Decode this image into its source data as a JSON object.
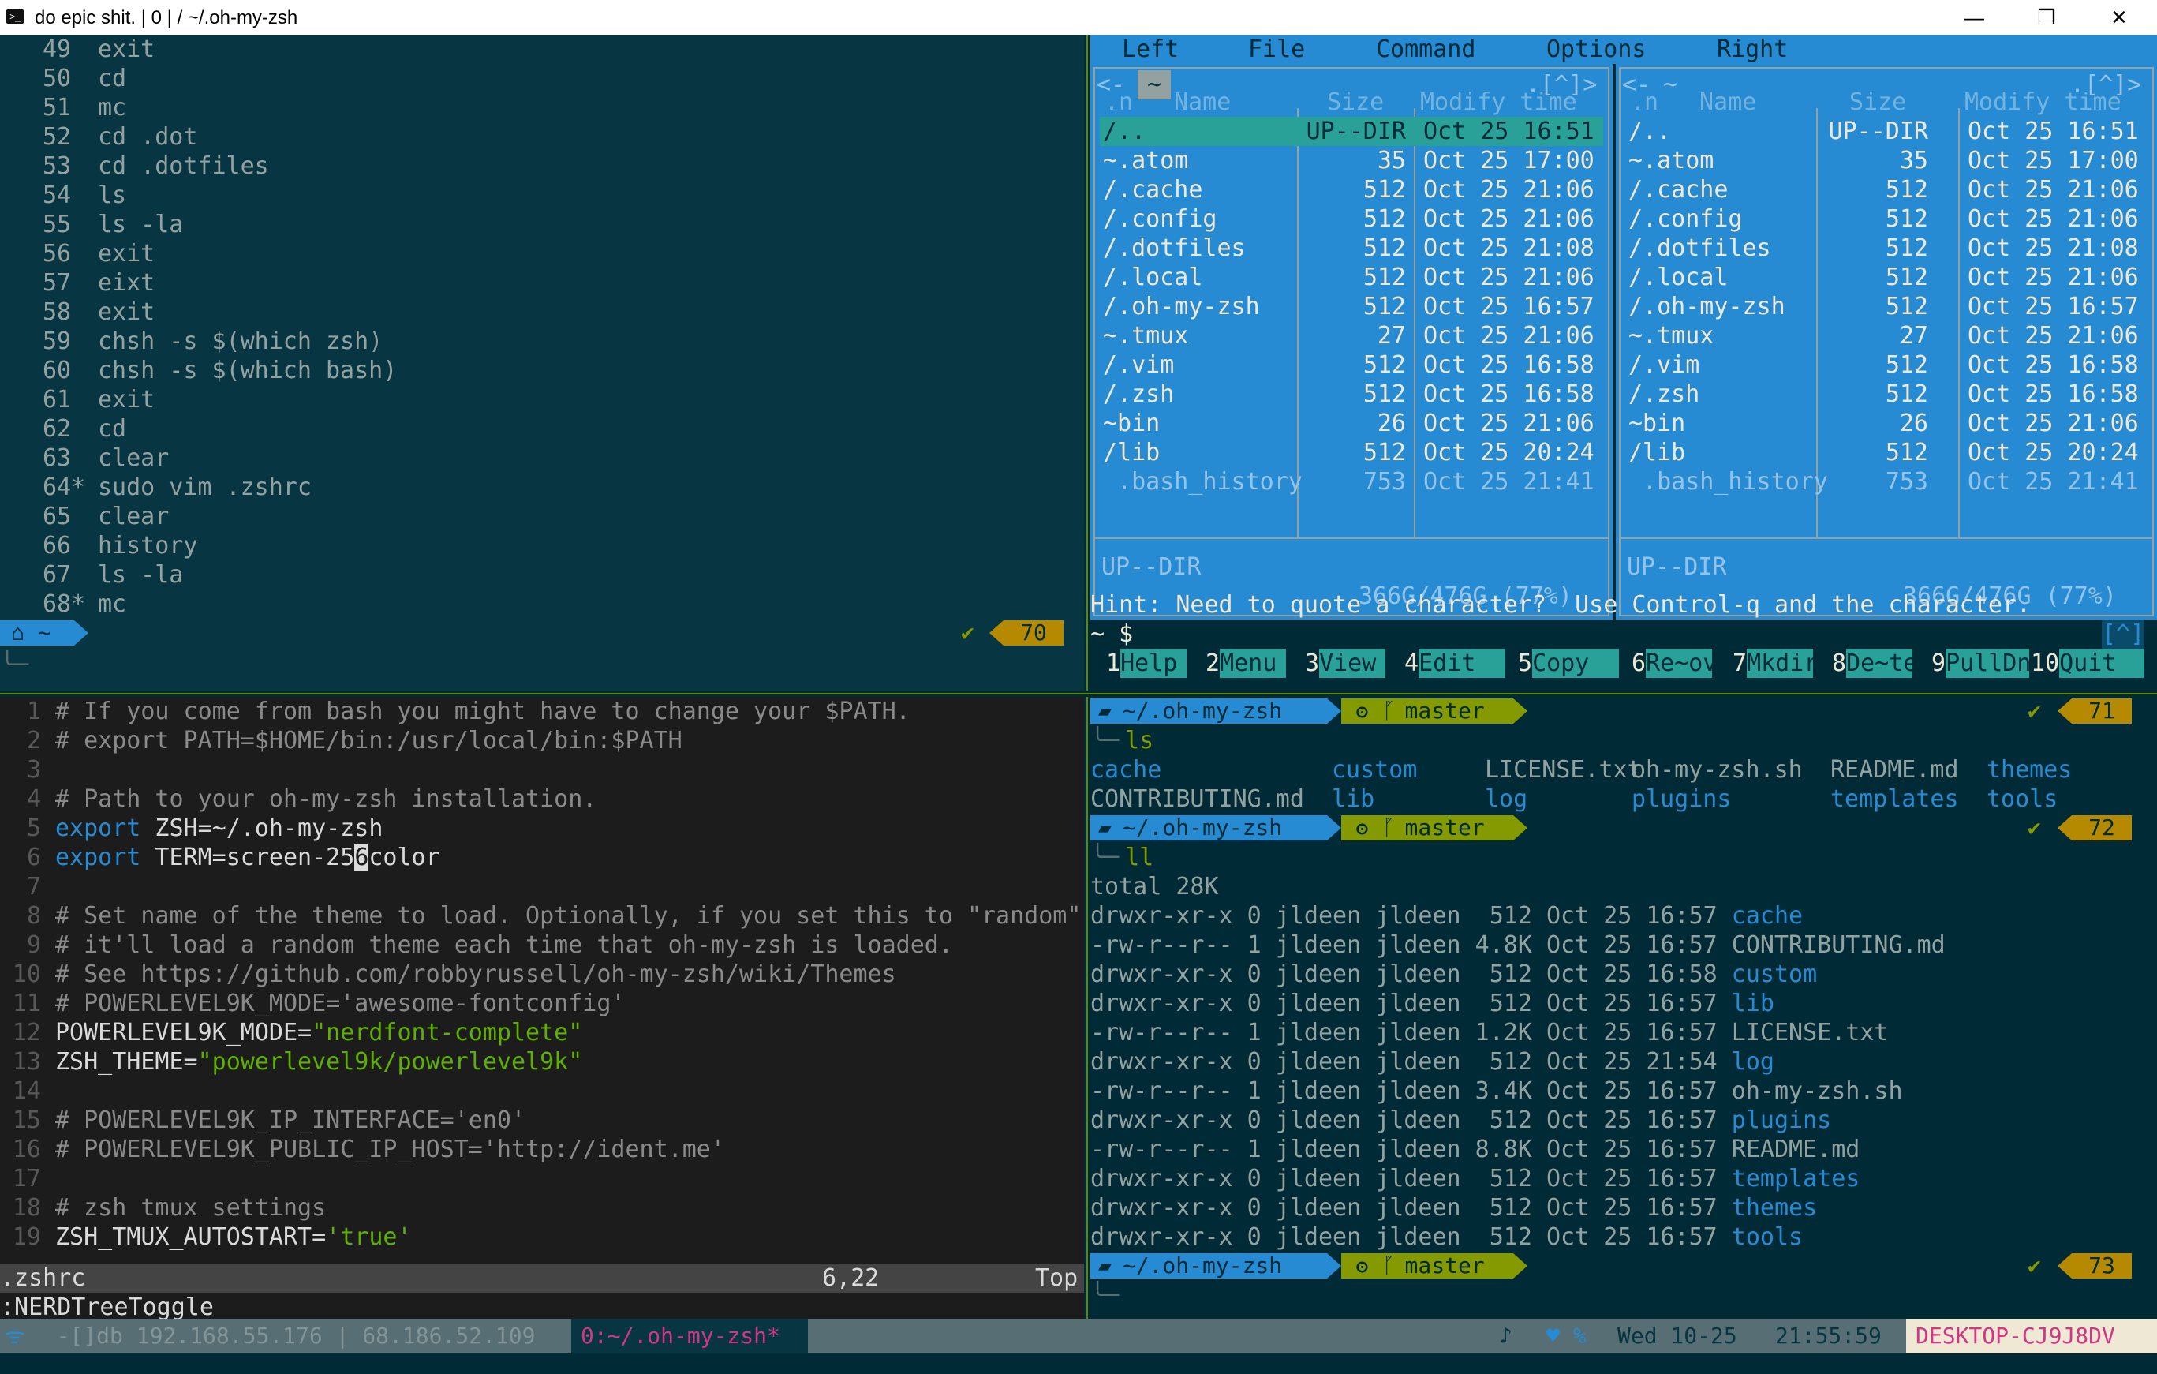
{
  "window": {
    "title": "do epic shit. | 0 | / ~/.oh-my-zsh",
    "minimize": "—",
    "maximize": "❐",
    "close": "✕"
  },
  "history": {
    "lines": [
      {
        "n": "49",
        "cmd": "exit"
      },
      {
        "n": "50",
        "cmd": "cd"
      },
      {
        "n": "51",
        "cmd": "mc"
      },
      {
        "n": "52",
        "cmd": "cd .dot"
      },
      {
        "n": "53",
        "cmd": "cd .dotfiles"
      },
      {
        "n": "54",
        "cmd": "ls"
      },
      {
        "n": "55",
        "cmd": "ls -la"
      },
      {
        "n": "56",
        "cmd": "exit"
      },
      {
        "n": "57",
        "cmd": "eixt"
      },
      {
        "n": "58",
        "cmd": "exit"
      },
      {
        "n": "59",
        "cmd": "chsh -s $(which zsh)"
      },
      {
        "n": "60",
        "cmd": "chsh -s $(which bash)"
      },
      {
        "n": "61",
        "cmd": "exit"
      },
      {
        "n": "62",
        "cmd": "cd"
      },
      {
        "n": "63",
        "cmd": "clear"
      },
      {
        "n": "64*",
        "cmd": "sudo vim .zshrc"
      },
      {
        "n": "65",
        "cmd": "clear"
      },
      {
        "n": "66",
        "cmd": "history"
      },
      {
        "n": "67",
        "cmd": "ls -la"
      },
      {
        "n": "68*",
        "cmd": "mc"
      }
    ],
    "prompt_dir": "~",
    "prompt_home_icon": "⌂",
    "check": "✔",
    "count": "70",
    "cursor_line": "╰─"
  },
  "mc": {
    "menu": [
      "Left",
      "File",
      "Command",
      "Options",
      "Right"
    ],
    "left_path": "~",
    "corner": ".[^]>",
    "left_marker": "<-",
    "headers": {
      "n": ".n",
      "name": "Name",
      "size": "Size",
      "mtime": "Modify time"
    },
    "rows": [
      {
        "name": "/..",
        "size": "UP--DIR",
        "date": "Oct 25 16:51"
      },
      {
        "name": "~.atom",
        "size": "35",
        "date": "Oct 25 17:00"
      },
      {
        "name": "/.cache",
        "size": "512",
        "date": "Oct 25 21:06"
      },
      {
        "name": "/.config",
        "size": "512",
        "date": "Oct 25 21:06"
      },
      {
        "name": "/.dotfiles",
        "size": "512",
        "date": "Oct 25 21:08"
      },
      {
        "name": "/.local",
        "size": "512",
        "date": "Oct 25 21:06"
      },
      {
        "name": "/.oh-my-zsh",
        "size": "512",
        "date": "Oct 25 16:57"
      },
      {
        "name": "~.tmux",
        "size": "27",
        "date": "Oct 25 21:06"
      },
      {
        "name": "/.vim",
        "size": "512",
        "date": "Oct 25 16:58"
      },
      {
        "name": "/.zsh",
        "size": "512",
        "date": "Oct 25 16:58"
      },
      {
        "name": "~bin",
        "size": "26",
        "date": "Oct 25 21:06"
      },
      {
        "name": "/lib",
        "size": "512",
        "date": "Oct 25 20:24"
      },
      {
        "name": " .bash_history",
        "size": "753",
        "date": "Oct 25 21:41"
      }
    ],
    "footer": "UP--DIR",
    "disk": "366G/476G (77%)",
    "hint": "Hint: Need to quote a character?  Use Control-q and the character.",
    "prompt": "~ $",
    "hint_corner": "[^]",
    "fkeys": [
      {
        "n": "1",
        "l": "Help"
      },
      {
        "n": "2",
        "l": "Menu"
      },
      {
        "n": "3",
        "l": "View"
      },
      {
        "n": "4",
        "l": "Edit"
      },
      {
        "n": "5",
        "l": "Copy"
      },
      {
        "n": "6",
        "l": "Re~ov"
      },
      {
        "n": "7",
        "l": "Mkdir"
      },
      {
        "n": "8",
        "l": "De~te"
      },
      {
        "n": "9",
        "l": "PullDn"
      },
      {
        "n": "10",
        "l": "Quit"
      }
    ]
  },
  "vim": {
    "lines": [
      {
        "n": "1",
        "parts": [
          {
            "c": "vc",
            "t": "# If you come from bash you might have to change your $PATH."
          }
        ]
      },
      {
        "n": "2",
        "parts": [
          {
            "c": "vc",
            "t": "# export PATH=$HOME/bin:/usr/local/bin:$PATH"
          }
        ]
      },
      {
        "n": "3",
        "parts": []
      },
      {
        "n": "4",
        "parts": [
          {
            "c": "vc",
            "t": "# Path to your oh-my-zsh installation."
          }
        ]
      },
      {
        "n": "5",
        "parts": [
          {
            "c": "vk",
            "t": "export"
          },
          {
            "c": "vt",
            "t": " ZSH=~/.oh-my-zsh"
          }
        ]
      },
      {
        "n": "6",
        "parts": [
          {
            "c": "vk",
            "t": "export"
          },
          {
            "c": "vt",
            "t": " TERM=screen-25"
          },
          {
            "c": "cursor",
            "t": "6"
          },
          {
            "c": "vt",
            "t": "color"
          }
        ]
      },
      {
        "n": "7",
        "parts": []
      },
      {
        "n": "8",
        "parts": [
          {
            "c": "vc",
            "t": "# Set name of the theme to load. Optionally, if you set this to \"random\""
          }
        ]
      },
      {
        "n": "9",
        "parts": [
          {
            "c": "vc",
            "t": "# it'll load a random theme each time that oh-my-zsh is loaded."
          }
        ]
      },
      {
        "n": "10",
        "parts": [
          {
            "c": "vc",
            "t": "# See https://github.com/robbyrussell/oh-my-zsh/wiki/Themes"
          }
        ]
      },
      {
        "n": "11",
        "parts": [
          {
            "c": "vc",
            "t": "# POWERLEVEL9K_MODE='awesome-fontconfig'"
          }
        ]
      },
      {
        "n": "12",
        "parts": [
          {
            "c": "vt",
            "t": "POWERLEVEL9K_MODE="
          },
          {
            "c": "vs",
            "t": "\"nerdfont-complete\""
          }
        ]
      },
      {
        "n": "13",
        "parts": [
          {
            "c": "vt",
            "t": "ZSH_THEME="
          },
          {
            "c": "vs",
            "t": "\"powerlevel9k/powerlevel9k\""
          }
        ]
      },
      {
        "n": "14",
        "parts": []
      },
      {
        "n": "15",
        "parts": [
          {
            "c": "vc",
            "t": "# POWERLEVEL9K_IP_INTERFACE='en0'"
          }
        ]
      },
      {
        "n": "16",
        "parts": [
          {
            "c": "vc",
            "t": "# POWERLEVEL9K_PUBLIC_IP_HOST='http://ident.me'"
          }
        ]
      },
      {
        "n": "17",
        "parts": []
      },
      {
        "n": "18",
        "parts": [
          {
            "c": "vc",
            "t": "# zsh tmux settings"
          }
        ]
      },
      {
        "n": "19",
        "parts": [
          {
            "c": "vt",
            "t": "ZSH_TMUX_AUTOSTART="
          },
          {
            "c": "vs",
            "t": "'true'"
          }
        ]
      }
    ],
    "status_file": ".zshrc",
    "status_pos": "6,22",
    "status_top": "Top",
    "cmdline": ":NERDTreeToggle"
  },
  "shell": {
    "prompt_path": "~/.oh-my-zsh",
    "branch": "master",
    "branch_icons": "ʘ  ᚵ",
    "folder_icon": "▰",
    "check": "✔",
    "ls_cmd": "ls",
    "ll_cmd": "ll",
    "cursor": "╰─",
    "counts": [
      "71",
      "72",
      "73"
    ],
    "ls_grid": [
      [
        {
          "t": "cache",
          "d": true
        },
        {
          "t": "custom",
          "d": true
        },
        {
          "t": "LICENSE.txt",
          "d": false
        },
        {
          "t": "oh-my-zsh.sh",
          "d": false
        },
        {
          "t": "README.md",
          "d": false
        },
        {
          "t": "themes",
          "d": true
        }
      ],
      [
        {
          "t": "CONTRIBUTING.md",
          "d": false
        },
        {
          "t": "lib",
          "d": true
        },
        {
          "t": "log",
          "d": true
        },
        {
          "t": "plugins",
          "d": true
        },
        {
          "t": "templates",
          "d": true
        },
        {
          "t": "tools",
          "d": true
        }
      ]
    ],
    "total": "total 28K",
    "ll": [
      {
        "p": "drwxr-xr-x 0 jldeen jldeen  512 Oct 25 16:57 ",
        "n": "cache",
        "d": true
      },
      {
        "p": "-rw-r--r-- 1 jldeen jldeen 4.8K Oct 25 16:57 ",
        "n": "CONTRIBUTING.md",
        "d": false
      },
      {
        "p": "drwxr-xr-x 0 jldeen jldeen  512 Oct 25 16:58 ",
        "n": "custom",
        "d": true
      },
      {
        "p": "drwxr-xr-x 0 jldeen jldeen  512 Oct 25 16:57 ",
        "n": "lib",
        "d": true
      },
      {
        "p": "-rw-r--r-- 1 jldeen jldeen 1.2K Oct 25 16:57 ",
        "n": "LICENSE.txt",
        "d": false
      },
      {
        "p": "drwxr-xr-x 0 jldeen jldeen  512 Oct 25 21:54 ",
        "n": "log",
        "d": true
      },
      {
        "p": "-rw-r--r-- 1 jldeen jldeen 3.4K Oct 25 16:57 ",
        "n": "oh-my-zsh.sh",
        "d": false
      },
      {
        "p": "drwxr-xr-x 0 jldeen jldeen  512 Oct 25 16:57 ",
        "n": "plugins",
        "d": true
      },
      {
        "p": "-rw-r--r-- 1 jldeen jldeen 8.8K Oct 25 16:57 ",
        "n": "README.md",
        "d": false
      },
      {
        "p": "drwxr-xr-x 0 jldeen jldeen  512 Oct 25 16:57 ",
        "n": "templates",
        "d": true
      },
      {
        "p": "drwxr-xr-x 0 jldeen jldeen  512 Oct 25 16:57 ",
        "n": "themes",
        "d": true
      },
      {
        "p": "drwxr-xr-x 0 jldeen jldeen  512 Oct 25 16:57 ",
        "n": "tools",
        "d": true
      }
    ]
  },
  "tmux": {
    "left_icon": "ᯤ",
    "ips": "-[]db 192.168.55.176 | 68.186.52.109",
    "window": "0:~/.oh-my-zsh*",
    "music": "♪",
    "heart": "♥ %",
    "date": "Wed 10-25",
    "time": "21:55:59",
    "host": "DESKTOP-CJ9J8DV"
  },
  "colors": {
    "accent": "#268bd2",
    "green": "#859900",
    "yellow": "#b58900",
    "cyan": "#2aa198",
    "magenta": "#d33682"
  }
}
